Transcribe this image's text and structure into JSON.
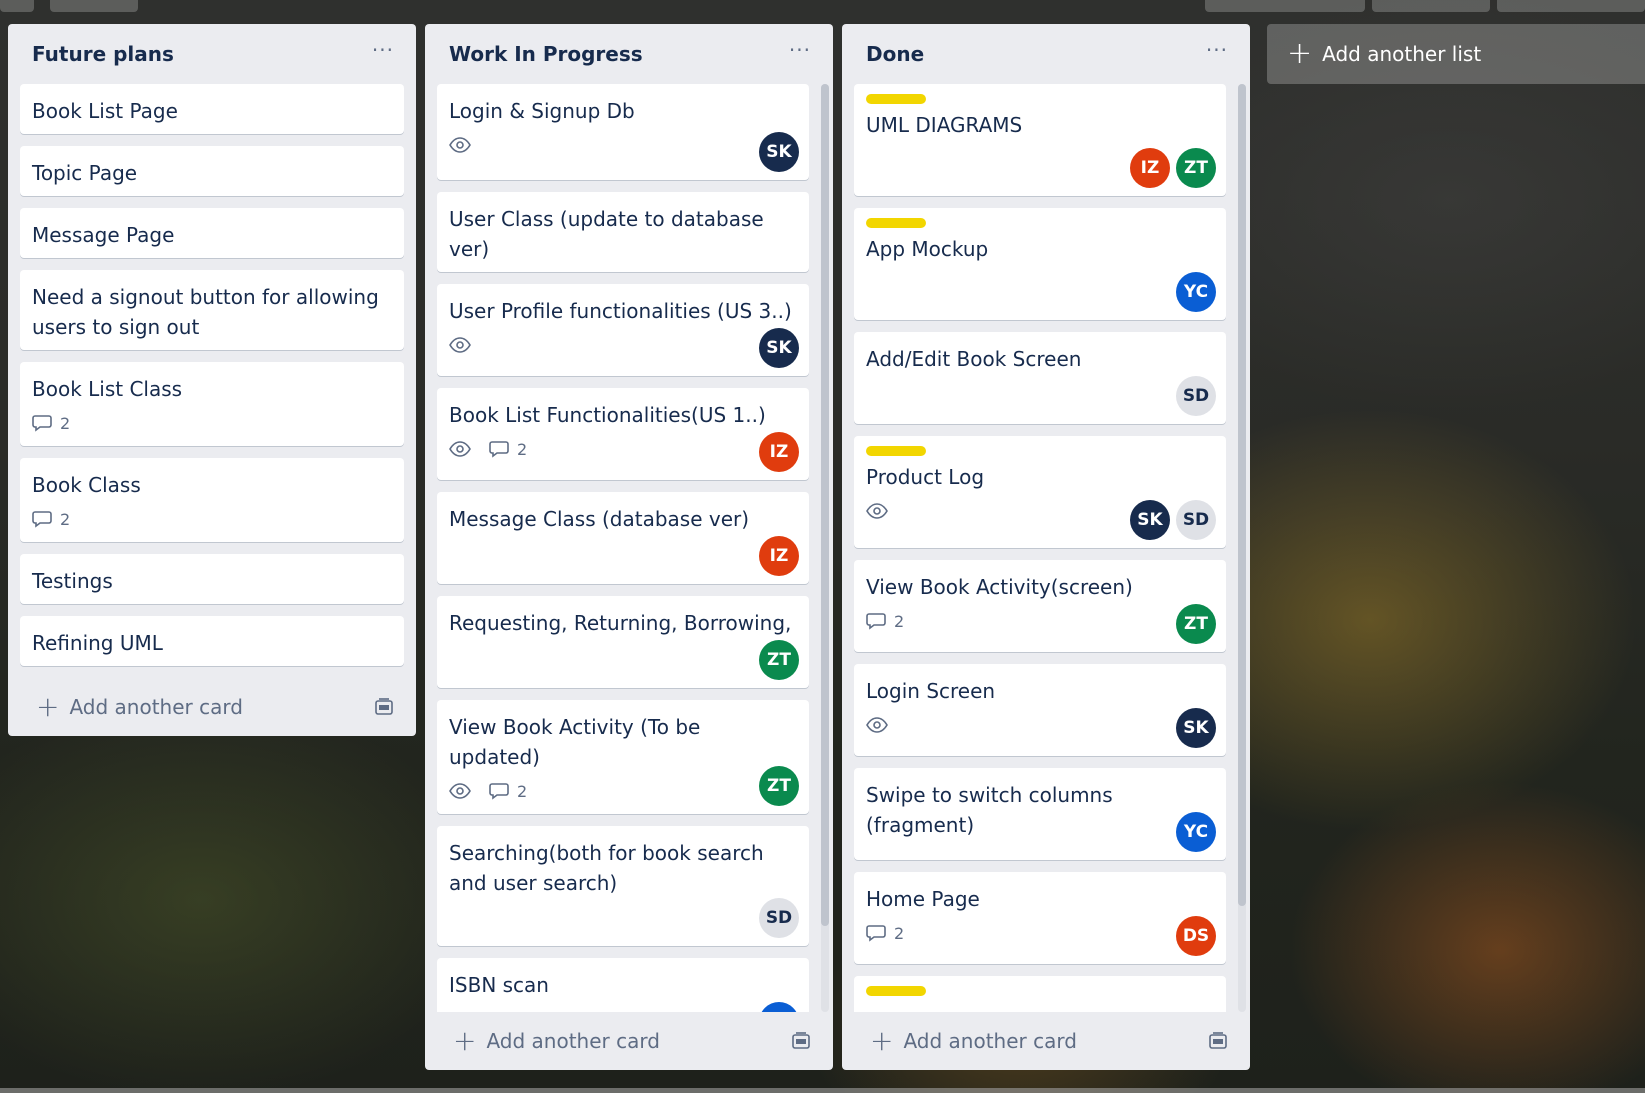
{
  "colors": {
    "list_bg": "#ebecf0",
    "card_bg": "#ffffff",
    "label_yellow": "#f2d600",
    "avatar_dark": "#172b4d",
    "avatar_orange": "#e03c0e",
    "avatar_green": "#0a8a4e",
    "avatar_blue": "#0a5ed4",
    "avatar_light": "#dfe1e6"
  },
  "lists": [
    {
      "title": "Future plans",
      "menu": "···",
      "add_card_label": "Add another card",
      "cards": [
        {
          "title": "Book List Page"
        },
        {
          "title": "Topic Page"
        },
        {
          "title": "Message Page"
        },
        {
          "title": "Need a signout button for allowing users to sign out"
        },
        {
          "title": "Book List Class",
          "comments": "2"
        },
        {
          "title": "Book Class",
          "comments": "2"
        },
        {
          "title": "Testings"
        },
        {
          "title": "Refining UML"
        }
      ]
    },
    {
      "title": "Work In Progress",
      "menu": "···",
      "add_card_label": "Add another card",
      "cards": [
        {
          "title": "Login & Signup Db",
          "watch": true,
          "members": [
            "SK"
          ]
        },
        {
          "title": "User Class (update to database ver)"
        },
        {
          "title": "User Profile functionalities (US 3..)",
          "watch": true,
          "members": [
            "SK"
          ]
        },
        {
          "title": "Book List Functionalities(US 1..)",
          "watch": true,
          "comments": "2",
          "members": [
            "IZ"
          ]
        },
        {
          "title": "Message Class (database ver)",
          "members": [
            "IZ"
          ]
        },
        {
          "title": "Requesting, Returning, Borrowing,",
          "members": [
            "ZT"
          ]
        },
        {
          "title": "View Book Activity (To be updated)",
          "watch": true,
          "comments": "2",
          "members": [
            "ZT"
          ]
        },
        {
          "title": "Searching(both for book search and user search)",
          "members": [
            "SD"
          ]
        },
        {
          "title": "ISBN scan",
          "members": [
            "YC"
          ]
        }
      ]
    },
    {
      "title": "Done",
      "menu": "···",
      "add_card_label": "Add another card",
      "cards": [
        {
          "title": "UML DIAGRAMS",
          "label": true,
          "members": [
            "IZ",
            "ZT"
          ]
        },
        {
          "title": "App Mockup",
          "label": true,
          "members": [
            "YC"
          ]
        },
        {
          "title": "Add/Edit Book Screen",
          "members": [
            "SD"
          ]
        },
        {
          "title": "Product Log",
          "label": true,
          "watch": true,
          "members": [
            "SK",
            "SD"
          ]
        },
        {
          "title": "View Book Activity(screen)",
          "comments": "2",
          "members": [
            "ZT"
          ]
        },
        {
          "title": "Login Screen",
          "watch": true,
          "members": [
            "SK"
          ]
        },
        {
          "title": "Swipe to switch columns (fragment)",
          "members": [
            "YC"
          ]
        },
        {
          "title": "Home Page",
          "comments": "2",
          "members": [
            "DS"
          ]
        },
        {
          "title": "",
          "label": true
        }
      ]
    }
  ],
  "add_list_label": "Add another list"
}
